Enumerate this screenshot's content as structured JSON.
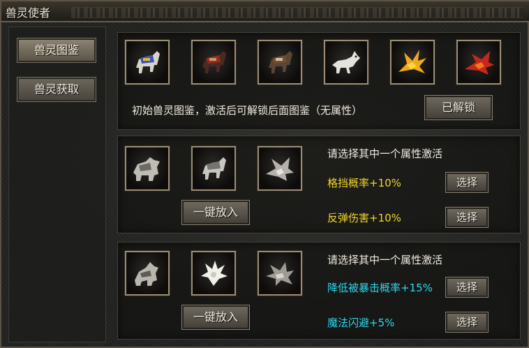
{
  "window": {
    "title": "兽灵使者"
  },
  "sidebar": {
    "items": [
      {
        "label": "兽灵图鉴",
        "active": true
      },
      {
        "label": "兽灵获取",
        "active": false
      }
    ]
  },
  "panel1": {
    "slots": [
      {
        "icon": "armored-horse-blue-icon"
      },
      {
        "icon": "armored-horse-red-icon"
      },
      {
        "icon": "armored-horse-brown-icon"
      },
      {
        "icon": "white-wolf-icon"
      },
      {
        "icon": "golden-phoenix-icon"
      },
      {
        "icon": "red-fire-bird-icon"
      }
    ],
    "description": "初始兽灵图鉴，激活后可解锁后面图鉴（无属性）",
    "unlock_label": "已解锁"
  },
  "panel2": {
    "slots": [
      {
        "icon": "silver-beast-icon"
      },
      {
        "icon": "silver-horse-icon"
      },
      {
        "icon": "silver-bird-icon"
      }
    ],
    "prompt": "请选择其中一个属性激活",
    "attrs": [
      {
        "text": "格挡概率+10%",
        "color": "#f2d72a",
        "button": "选择"
      },
      {
        "text": "反弹伤害+10%",
        "color": "#f2d72a",
        "button": "选择"
      }
    ],
    "onekey_label": "一键放入"
  },
  "panel3": {
    "slots": [
      {
        "icon": "silver-wolf-icon"
      },
      {
        "icon": "white-phoenix-icon"
      },
      {
        "icon": "silver-dragon-bird-icon"
      }
    ],
    "prompt": "请选择其中一个属性激活",
    "attrs": [
      {
        "text": "降低被暴击概率+15%",
        "color": "#2fd8ee",
        "button": "选择"
      },
      {
        "text": "魔法闪避+5%",
        "color": "#2fd8ee",
        "button": "选择"
      }
    ],
    "onekey_label": "一键放入"
  }
}
